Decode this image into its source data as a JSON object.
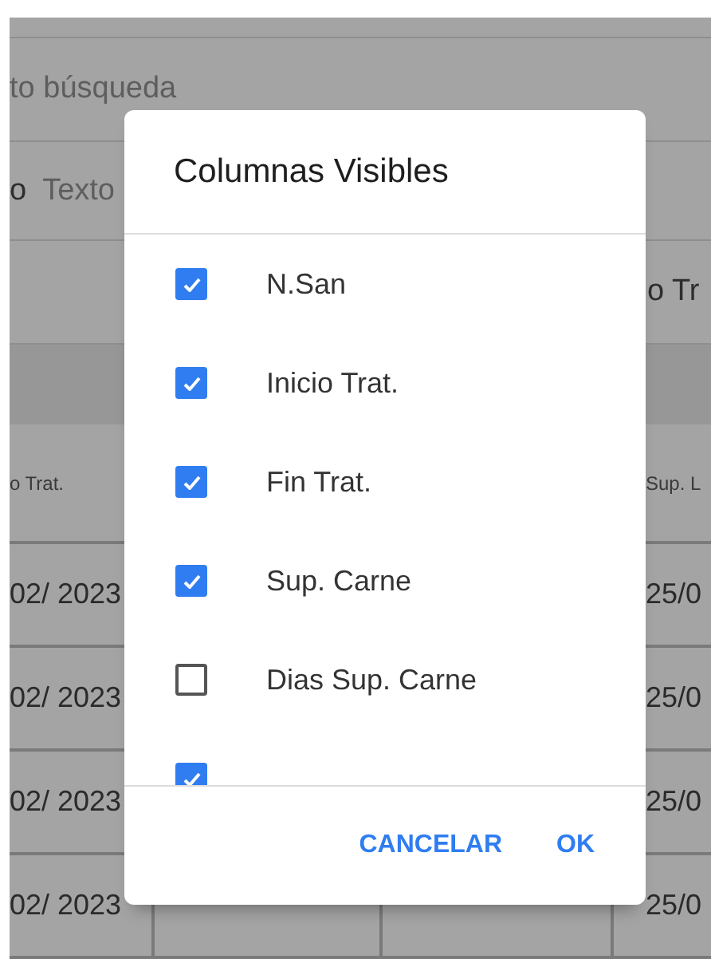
{
  "background": {
    "search_placeholder": "to búsqueda",
    "filter_row": {
      "label": "o",
      "placeholder": "Texto"
    },
    "column_label": "o Tr",
    "table": {
      "columns": {
        "column_1": "o Trat.",
        "column_4": "Sup. L"
      },
      "rows": [
        {
          "column_1": "02/ 2023",
          "column_4": "25/0"
        },
        {
          "column_1": "02/ 2023",
          "column_4": "25/0"
        },
        {
          "column_1": "02/ 2023",
          "column_4": "25/0"
        },
        {
          "column_1": "02/ 2023",
          "column_4": "25/0"
        }
      ]
    }
  },
  "dialog": {
    "title": "Columnas Visibles",
    "items": [
      {
        "label": "N.San",
        "checked": true
      },
      {
        "label": "Inicio Trat.",
        "checked": true
      },
      {
        "label": "Fin Trat.",
        "checked": true
      },
      {
        "label": "Sup. Carne",
        "checked": true
      },
      {
        "label": "Dias Sup. Carne",
        "checked": false
      },
      {
        "checked": true
      }
    ],
    "buttons": [
      "CANCELAR",
      "OK"
    ]
  }
}
